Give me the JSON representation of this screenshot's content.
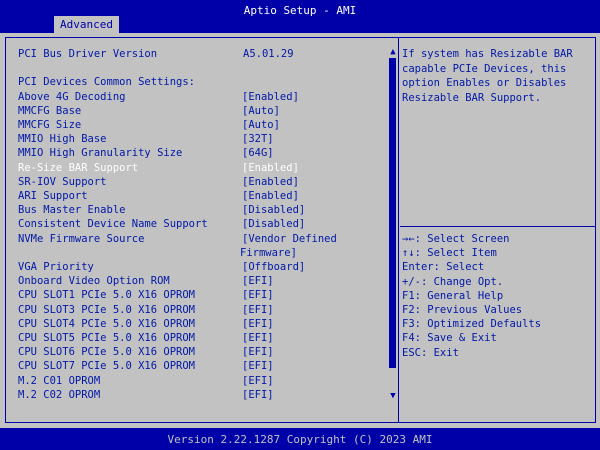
{
  "header": {
    "title": "Aptio Setup - AMI",
    "tab": "Advanced"
  },
  "settings": [
    {
      "label": "PCI Bus Driver Version",
      "value": "A5.01.29",
      "static": true
    },
    {
      "label": "",
      "value": ""
    },
    {
      "label": "PCI Devices Common Settings:",
      "value": "",
      "static": true
    },
    {
      "label": "Above 4G Decoding",
      "value": "[Enabled]"
    },
    {
      "label": "MMCFG Base",
      "value": "[Auto]"
    },
    {
      "label": "MMCFG Size",
      "value": "[Auto]"
    },
    {
      "label": "MMIO High Base",
      "value": "[32T]"
    },
    {
      "label": "MMIO High Granularity Size",
      "value": "[64G]"
    },
    {
      "label": "Re-Size BAR Support",
      "value": "[Enabled]",
      "selected": true
    },
    {
      "label": "SR-IOV Support",
      "value": "[Enabled]"
    },
    {
      "label": "ARI Support",
      "value": "[Enabled]"
    },
    {
      "label": "Bus Master Enable",
      "value": "[Disabled]"
    },
    {
      "label": "Consistent Device Name Support",
      "value": "[Disabled]"
    },
    {
      "label": "NVMe Firmware Source",
      "value": "[Vendor Defined"
    },
    {
      "label": "",
      "value": "Firmware]",
      "continuation": true
    },
    {
      "label": "VGA Priority",
      "value": "[Offboard]"
    },
    {
      "label": "Onboard Video Option ROM",
      "value": "[EFI]"
    },
    {
      "label": "CPU SLOT1 PCIe 5.0 X16 OPROM",
      "value": "[EFI]"
    },
    {
      "label": "CPU SLOT3 PCIe 5.0 X16 OPROM",
      "value": "[EFI]"
    },
    {
      "label": "CPU SLOT4 PCIe 5.0 X16 OPROM",
      "value": "[EFI]"
    },
    {
      "label": "CPU SLOT5 PCIe 5.0 X16 OPROM",
      "value": "[EFI]"
    },
    {
      "label": "CPU SLOT6 PCIe 5.0 X16 OPROM",
      "value": "[EFI]"
    },
    {
      "label": "CPU SLOT7 PCIe 5.0 X16 OPROM",
      "value": "[EFI]"
    },
    {
      "label": "M.2 C01 OPROM",
      "value": "[EFI]"
    },
    {
      "label": "M.2 C02 OPROM",
      "value": "[EFI]"
    }
  ],
  "help": [
    "If system has Resizable BAR",
    "capable PCIe Devices, this",
    "option Enables or Disables",
    "Resizable BAR Support."
  ],
  "keys": [
    "→←: Select Screen",
    "↑↓: Select Item",
    "Enter: Select",
    "+/-: Change Opt.",
    "F1: General Help",
    "F2: Previous Values",
    "F3: Optimized Defaults",
    "F4: Save & Exit",
    "ESC: Exit"
  ],
  "footer": {
    "version": "Version 2.22.1287 Copyright (C) 2023 AMI"
  },
  "scrollbar": {
    "up_glyph": "▲",
    "down_glyph": "▼"
  }
}
